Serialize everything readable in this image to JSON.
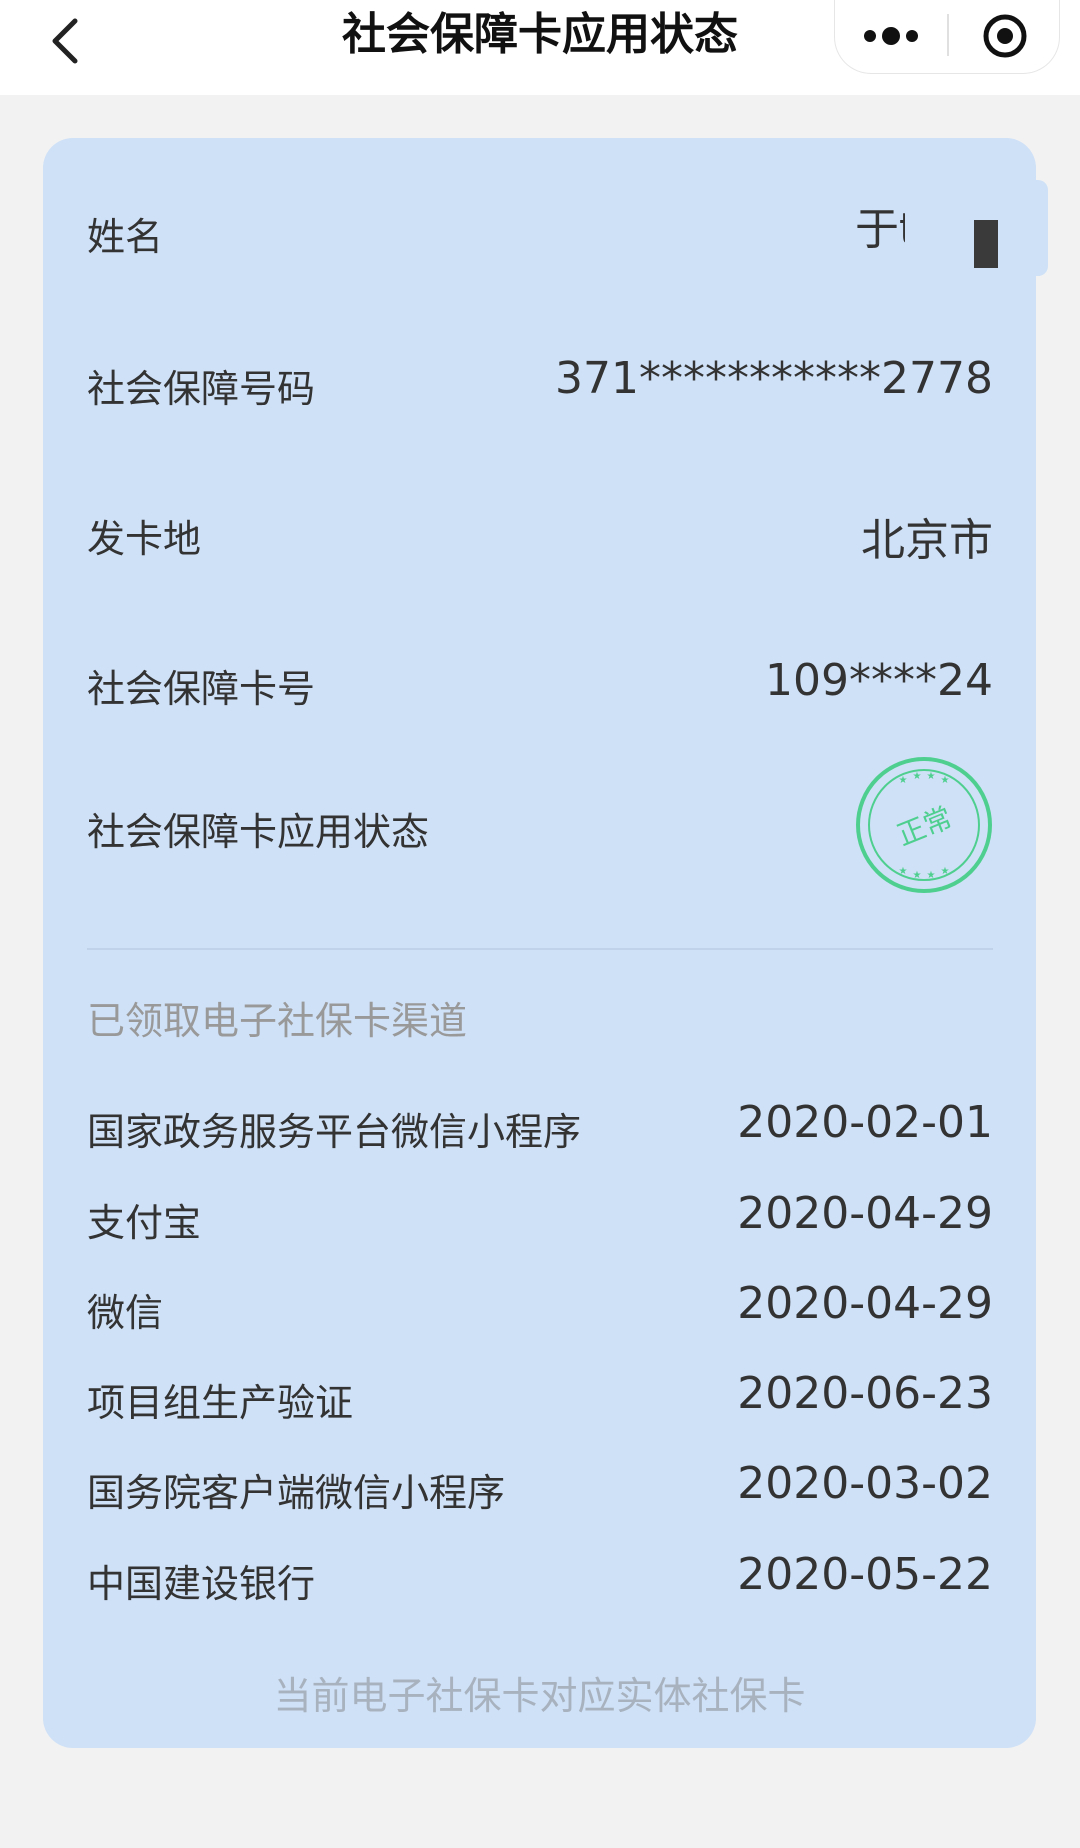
{
  "nav": {
    "title": "社会保障卡应用状态",
    "back_icon": "chevron-left-icon",
    "more_icon": "more-dots-icon",
    "close_icon": "target-close-icon"
  },
  "card": {
    "name_label": "姓名",
    "name_value": "于t",
    "ssn_label": "社会保障号码",
    "ssn_value": "371***********2778",
    "issue_place_label": "发卡地",
    "issue_place_value": "北京市",
    "card_no_label": "社会保障卡号",
    "card_no_value": "109****24",
    "status_label": "社会保障卡应用状态",
    "status_stamp": "正常"
  },
  "channels": {
    "title": "已领取电子社保卡渠道",
    "items": [
      {
        "name": "国家政务服务平台微信小程序",
        "date": "2020-02-01"
      },
      {
        "name": "支付宝",
        "date": "2020-04-29"
      },
      {
        "name": "微信",
        "date": "2020-04-29"
      },
      {
        "name": "项目组生产验证",
        "date": "2020-06-23"
      },
      {
        "name": "国务院客户端微信小程序",
        "date": "2020-03-02"
      },
      {
        "name": "中国建设银行",
        "date": "2020-05-22"
      }
    ]
  },
  "footer_note": "当前电子社保卡对应实体社保卡",
  "colors": {
    "card_bg": "#cfe1f7",
    "page_bg": "#f2f2f2",
    "stamp_green": "#4fcf8f"
  }
}
